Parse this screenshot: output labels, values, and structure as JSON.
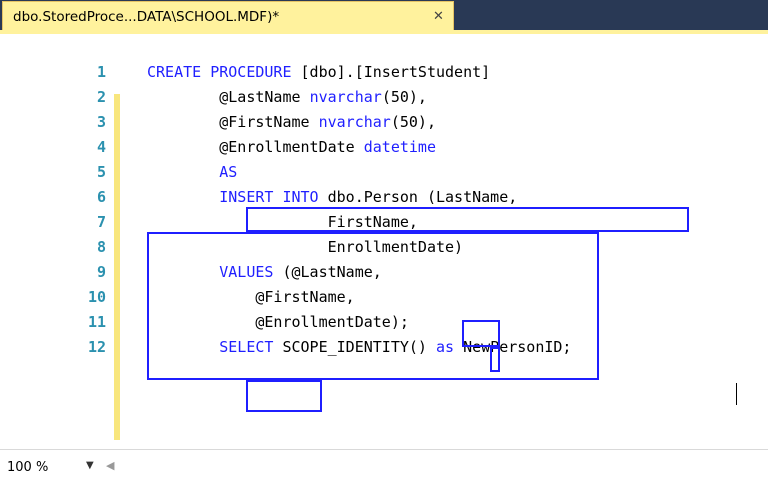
{
  "tab": {
    "title": "dbo.StoredProce...DATA\\SCHOOL.MDF)*",
    "close_glyph": "✕"
  },
  "editor": {
    "lines": [
      {
        "number": "1",
        "tokens": [
          {
            "t": "CREATE PROCEDURE",
            "k": true
          },
          {
            "t": " [dbo].[InsertStudent]",
            "k": false
          }
        ]
      },
      {
        "number": "2",
        "tokens": [
          {
            "t": "        @LastName ",
            "k": false
          },
          {
            "t": "nvarchar",
            "k": true
          },
          {
            "t": "(50),",
            "k": false
          }
        ]
      },
      {
        "number": "3",
        "tokens": [
          {
            "t": "        @FirstName ",
            "k": false
          },
          {
            "t": "nvarchar",
            "k": true
          },
          {
            "t": "(50),",
            "k": false
          }
        ]
      },
      {
        "number": "4",
        "tokens": [
          {
            "t": "        @EnrollmentDate ",
            "k": false
          },
          {
            "t": "datetime",
            "k": true
          }
        ]
      },
      {
        "number": "5",
        "tokens": [
          {
            "t": "        ",
            "k": false
          },
          {
            "t": "AS",
            "k": true
          }
        ]
      },
      {
        "number": "6",
        "tokens": [
          {
            "t": "        ",
            "k": false
          },
          {
            "t": "INSERT INTO",
            "k": true
          },
          {
            "t": " dbo.Person (LastName,",
            "k": false
          }
        ]
      },
      {
        "number": "7",
        "tokens": [
          {
            "t": "                    FirstName,",
            "k": false
          }
        ]
      },
      {
        "number": "8",
        "tokens": [
          {
            "t": "                    EnrollmentDate)",
            "k": false
          }
        ]
      },
      {
        "number": "9",
        "tokens": [
          {
            "t": "        ",
            "k": false
          },
          {
            "t": "VALUES",
            "k": true
          },
          {
            "t": " (@LastName,",
            "k": false
          }
        ]
      },
      {
        "number": "10",
        "tokens": [
          {
            "t": "            @FirstName,",
            "k": false
          }
        ]
      },
      {
        "number": "11",
        "tokens": [
          {
            "t": "            @EnrollmentDate);",
            "k": false
          }
        ]
      },
      {
        "number": "12",
        "tokens": [
          {
            "t": "        ",
            "k": false
          },
          {
            "t": "SELECT",
            "k": true
          },
          {
            "t": " SCOPE_IDENTITY() ",
            "k": false
          },
          {
            "t": "as",
            "k": true
          },
          {
            "t": " NewPersonID;",
            "k": false
          }
        ]
      }
    ]
  },
  "statusbar": {
    "zoom": "100 %",
    "zoom_arrow": "▼",
    "scroll_left": "◀"
  },
  "colors": {
    "keyword": "#1f1fff",
    "line_number": "#2b91af",
    "highlight_border": "#1f1fff",
    "tab_background": "#fff29d"
  }
}
